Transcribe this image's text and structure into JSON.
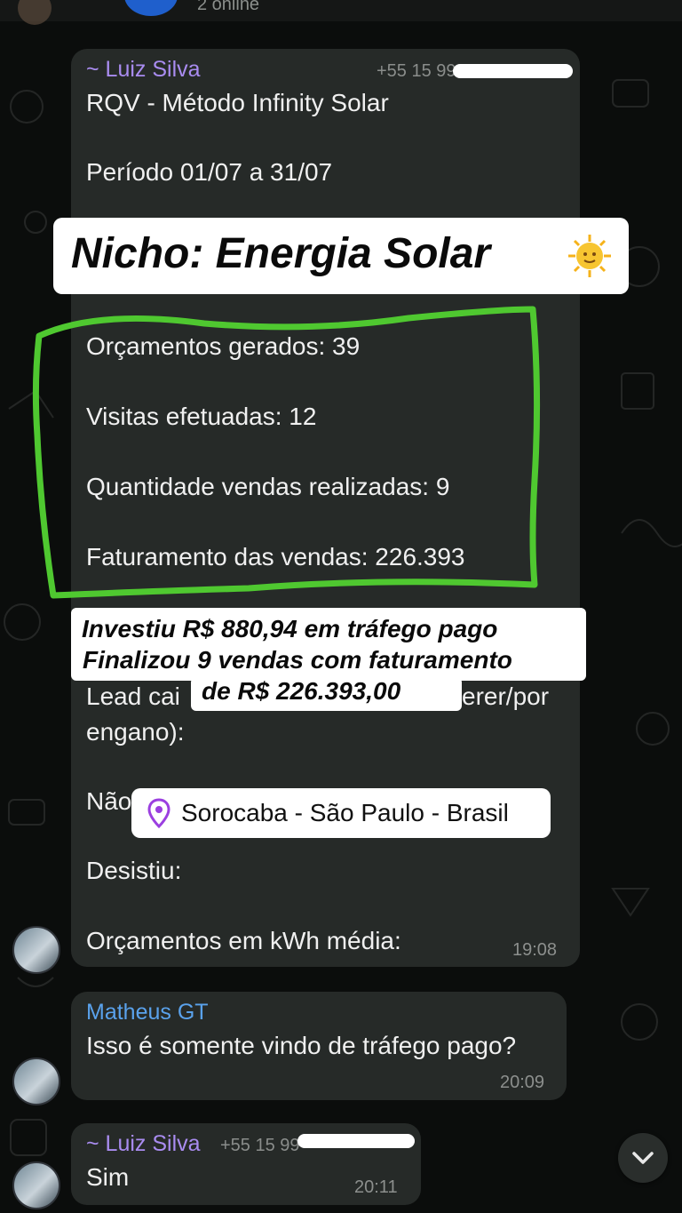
{
  "header": {
    "online_status": "2 online"
  },
  "message1": {
    "sender": "~ Luiz Silva",
    "phone_partial": "+55 15 99",
    "title": "RQV - Método Infinity Solar",
    "period": "Período 01/07 a 31/07",
    "stats": [
      "Orçamentos gerados: 39",
      "Visitas efetuadas: 12",
      "Quantidade vendas realizadas: 9",
      "Faturamento das vendas: 226.393"
    ],
    "lead_line_start": "Lead cai",
    "lead_line_end": "erer/por",
    "lead_line2": "engano):",
    "nao": "Não",
    "desistiu": "Desistiu:",
    "kwh": "Orçamentos em kWh média:",
    "time": "19:08"
  },
  "overlays": {
    "nicho": "Nicho: Energia Solar",
    "invest_lines": [
      "Investiu R$ 880,94 em tráfego pago",
      "Finalizou 9 vendas com faturamento",
      "de R$ 226.393,00"
    ],
    "location": "Sorocaba - São Paulo - Brasil"
  },
  "message2": {
    "sender": "Matheus GT",
    "text": "Isso é somente vindo de tráfego pago?",
    "time": "20:09"
  },
  "message3": {
    "sender": "~ Luiz Silva",
    "phone_partial": "+55 15 99",
    "text": "Sim",
    "time": "20:11"
  },
  "colors": {
    "sender_purple": "#a98cf0",
    "sender_blue": "#5aa2ec",
    "green_highlight": "#4fc830",
    "bubble": "#262a28"
  },
  "icons": [
    "location-pin-icon",
    "sun-emoji-icon",
    "chevron-down-icon"
  ]
}
